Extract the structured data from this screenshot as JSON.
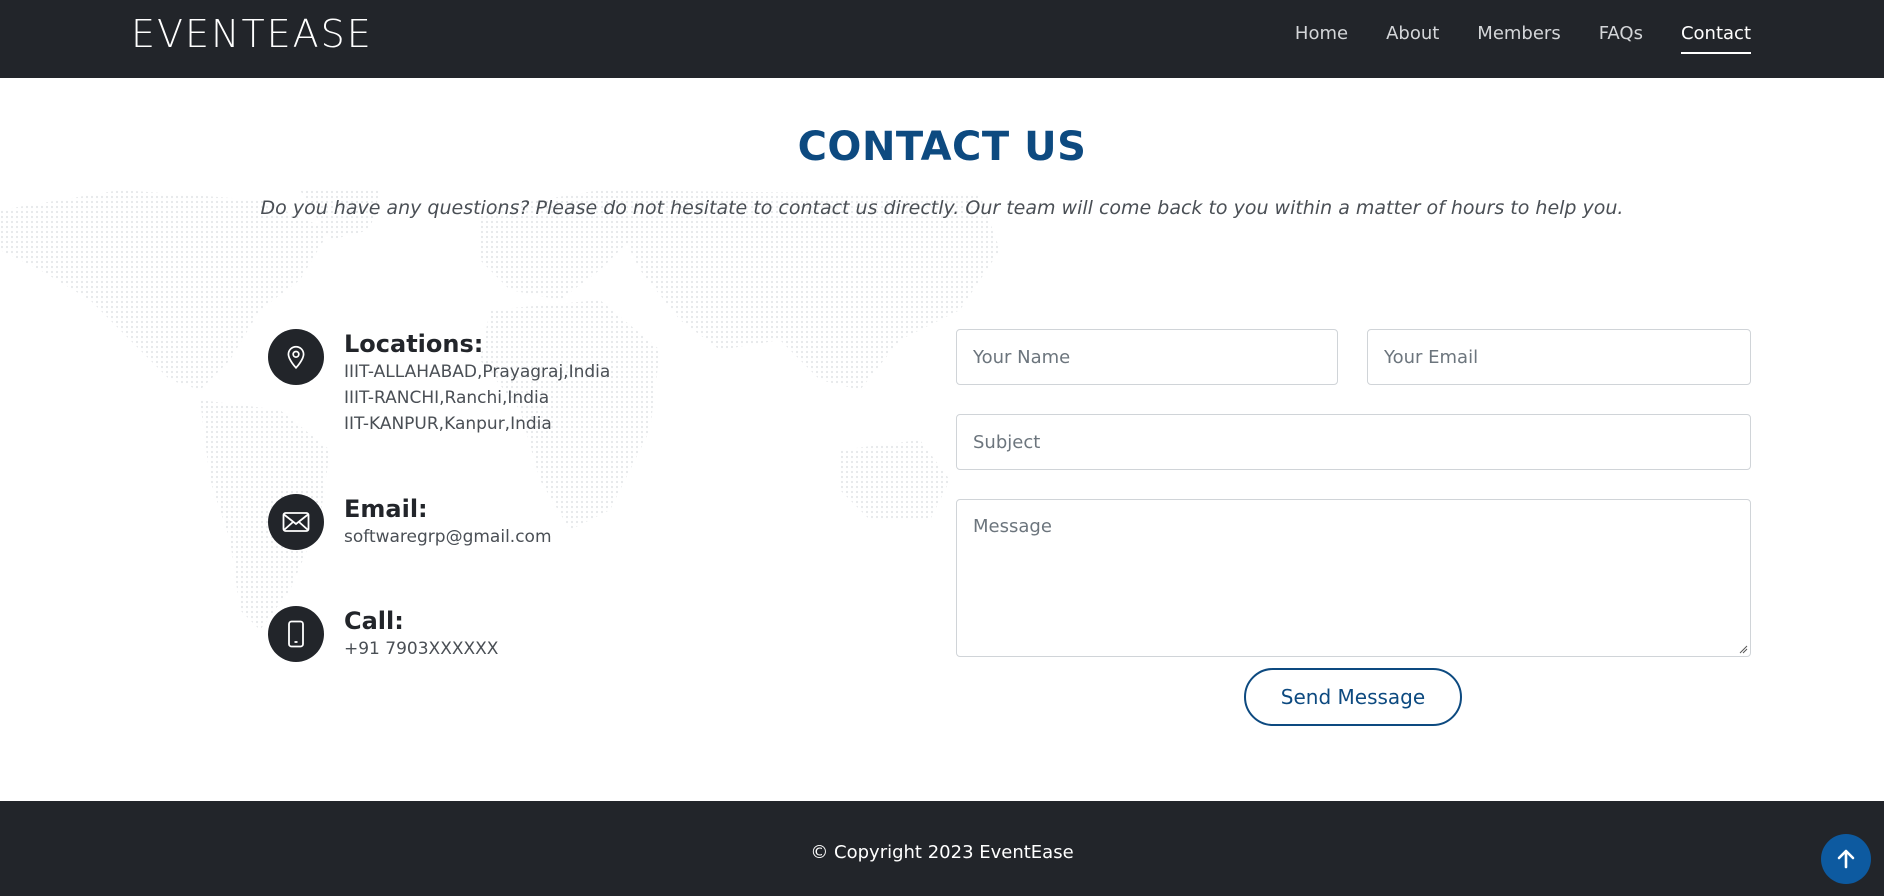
{
  "header": {
    "logo": "EVENTEASE",
    "nav": [
      {
        "label": "Home",
        "active": false
      },
      {
        "label": "About",
        "active": false
      },
      {
        "label": "Members",
        "active": false
      },
      {
        "label": "FAQs",
        "active": false
      },
      {
        "label": "Contact",
        "active": true
      }
    ]
  },
  "contact": {
    "title": "CONTACT US",
    "subtitle": "Do you have any questions? Please do not hesitate to contact us directly. Our team will come back to you within a matter of hours to help you.",
    "locations": {
      "title": "Locations:",
      "icon": "map-pin-icon",
      "lines": [
        "IIIT-ALLAHABAD,Prayagraj,India",
        "IIIT-RANCHI,Ranchi,India",
        "IIT-KANPUR,Kanpur,India"
      ]
    },
    "email": {
      "title": "Email:",
      "icon": "envelope-icon",
      "value": "softwaregrp@gmail.com"
    },
    "call": {
      "title": "Call:",
      "icon": "phone-icon",
      "value": "+91 7903XXXXXX"
    }
  },
  "form": {
    "name_placeholder": "Your Name",
    "email_placeholder": "Your Email",
    "subject_placeholder": "Subject",
    "message_placeholder": "Message",
    "submit_label": "Send Message"
  },
  "footer": {
    "copyright": "© Copyright 2023 EventEase",
    "back_to_top_icon": "arrow-up-icon"
  },
  "colors": {
    "dark": "#22252a",
    "accent": "#0d4a80",
    "back_to_top": "#0d5aa0"
  }
}
